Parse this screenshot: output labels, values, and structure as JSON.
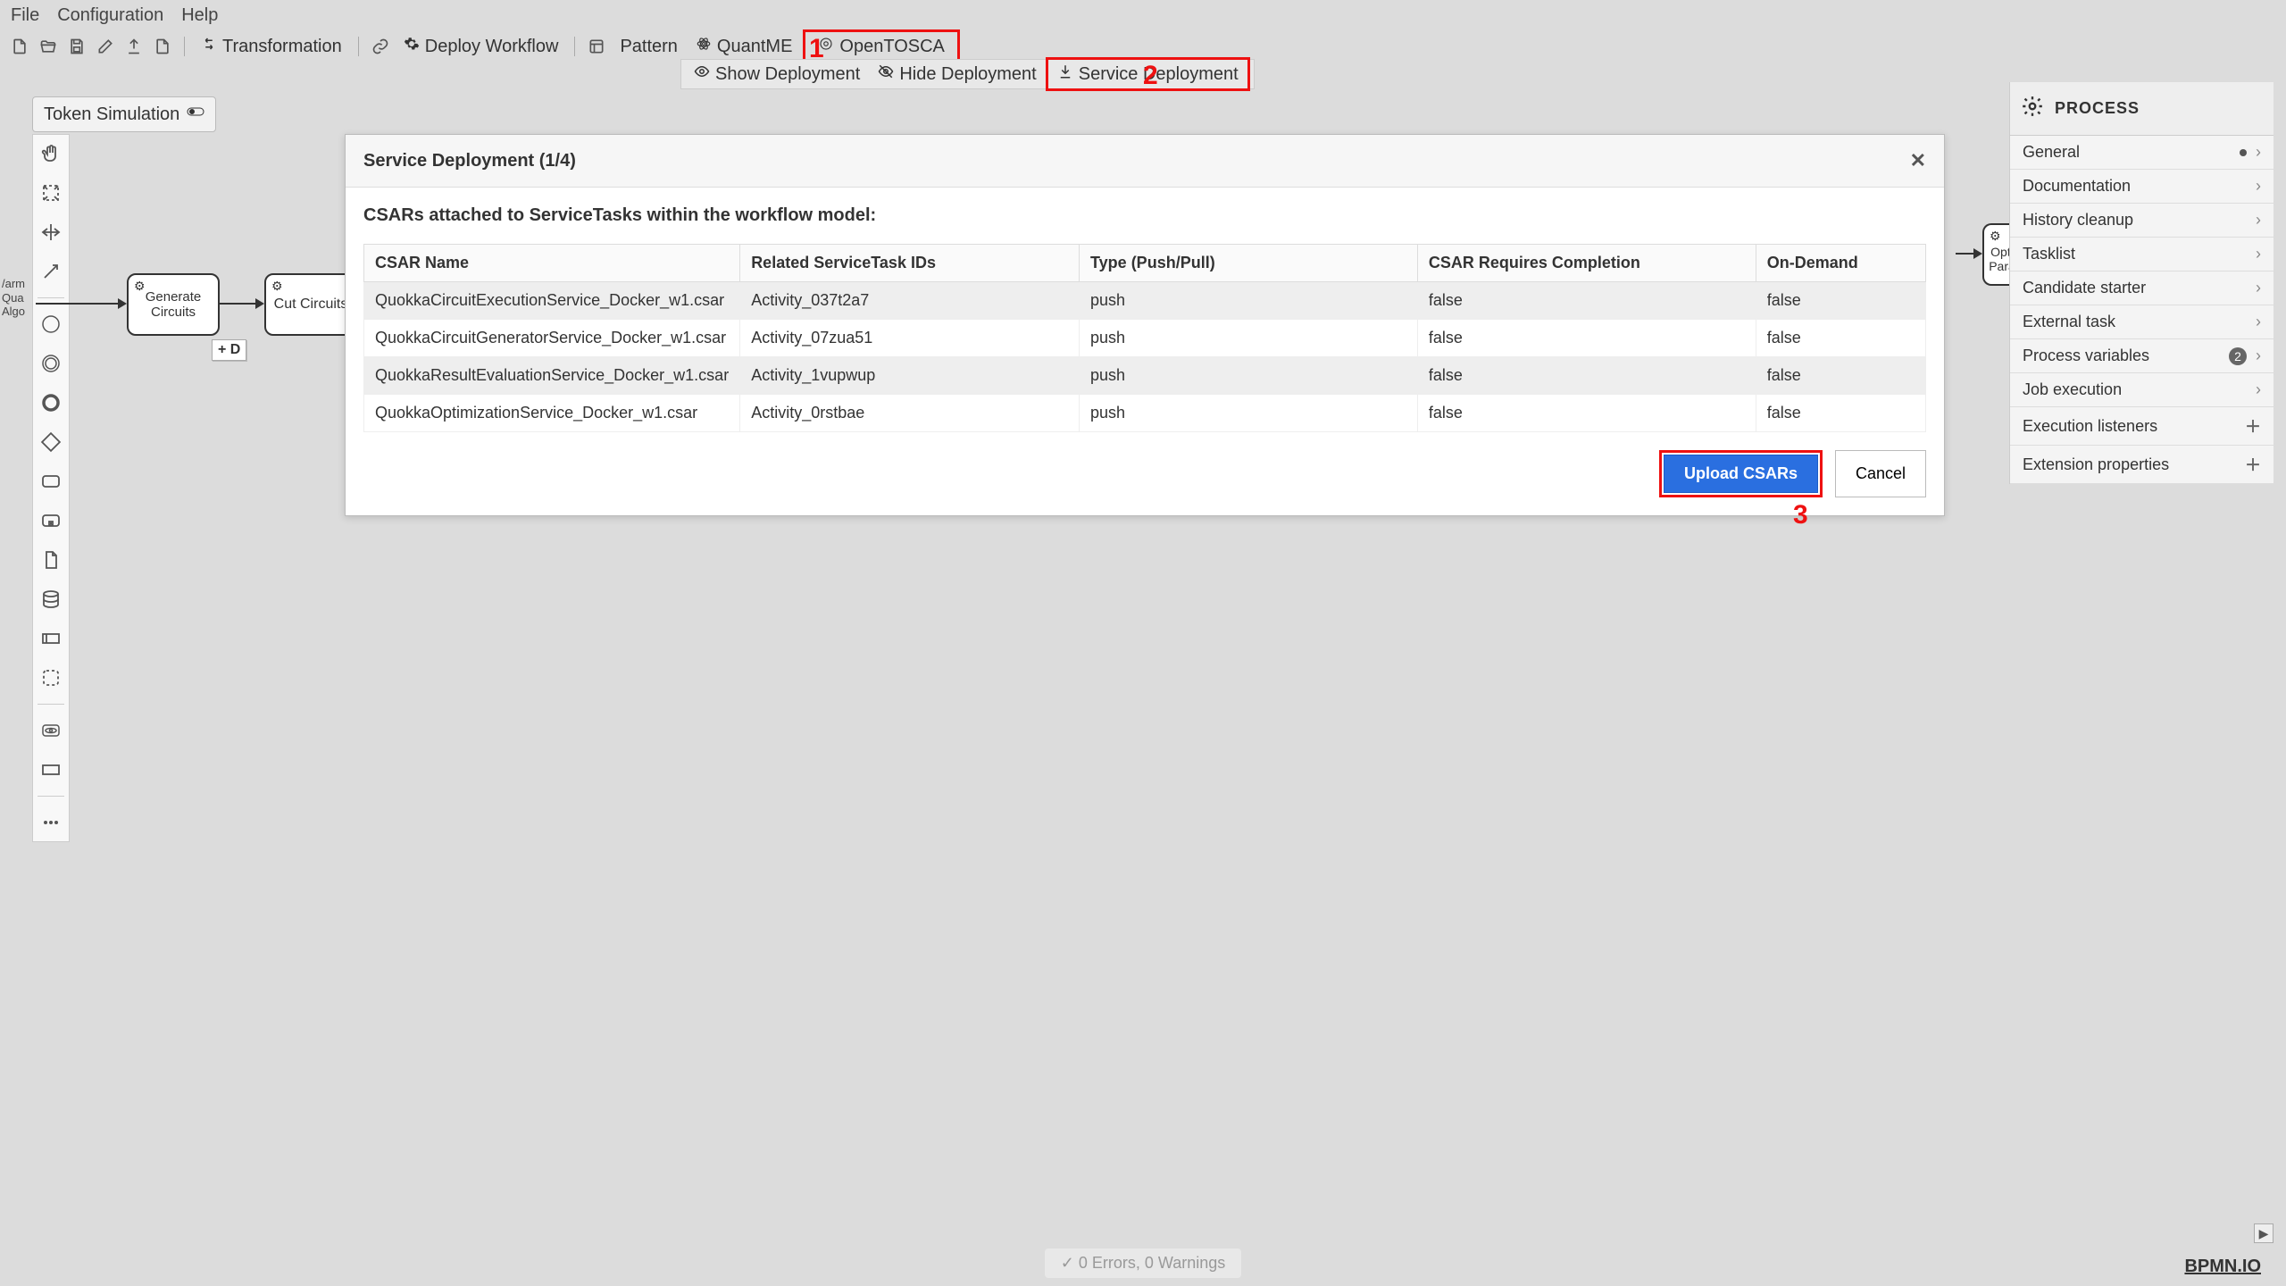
{
  "menu": {
    "file": "File",
    "configuration": "Configuration",
    "help": "Help"
  },
  "toolbar": {
    "transformation": "Transformation",
    "deploy_workflow": "Deploy Workflow",
    "pattern": "Pattern",
    "quantme": "QuantME",
    "opentosca": "OpenTOSCA"
  },
  "subbar": {
    "show_deployment": "Show Deployment",
    "hide_deployment": "Hide Deployment",
    "service_deployment": "Service Deployment"
  },
  "annotations": {
    "n1": "1",
    "n2": "2",
    "n3": "3"
  },
  "token_sim": "Token Simulation",
  "nodes": {
    "left_partial": "/arm\nQua\nAlgo",
    "generate": "Generate\nCircuits",
    "cut": "Cut Circuits",
    "plus_d": "+ D",
    "right_partial": "Opti\nPara"
  },
  "modal": {
    "title": "Service Deployment (1/4)",
    "desc": "CSARs attached to ServiceTasks within the workflow model:",
    "headers": {
      "name": "CSAR Name",
      "rel": "Related ServiceTask IDs",
      "type": "Type (Push/Pull)",
      "req": "CSAR Requires Completion",
      "ond": "On-Demand"
    },
    "rows": [
      {
        "name": "QuokkaCircuitExecutionService_Docker_w1.csar",
        "rel": "Activity_037t2a7",
        "type": "push",
        "req": "false",
        "ond": "false"
      },
      {
        "name": "QuokkaCircuitGeneratorService_Docker_w1.csar",
        "rel": "Activity_07zua51",
        "type": "push",
        "req": "false",
        "ond": "false"
      },
      {
        "name": "QuokkaResultEvaluationService_Docker_w1.csar",
        "rel": "Activity_1vupwup",
        "type": "push",
        "req": "false",
        "ond": "false"
      },
      {
        "name": "QuokkaOptimizationService_Docker_w1.csar",
        "rel": "Activity_0rstbae",
        "type": "push",
        "req": "false",
        "ond": "false"
      }
    ],
    "upload": "Upload CSARs",
    "cancel": "Cancel"
  },
  "right_panel": {
    "title": "PROCESS",
    "items": {
      "general": "General",
      "documentation": "Documentation",
      "history_cleanup": "History cleanup",
      "tasklist": "Tasklist",
      "candidate_starter": "Candidate starter",
      "external_task": "External task",
      "process_variables": "Process variables",
      "process_variables_badge": "2",
      "job_exec": "Job execution",
      "exec_listeners": "Execution listeners",
      "ext_props": "Extension properties"
    }
  },
  "status": "0 Errors, 0 Warnings",
  "branding": "BPMN.IO"
}
